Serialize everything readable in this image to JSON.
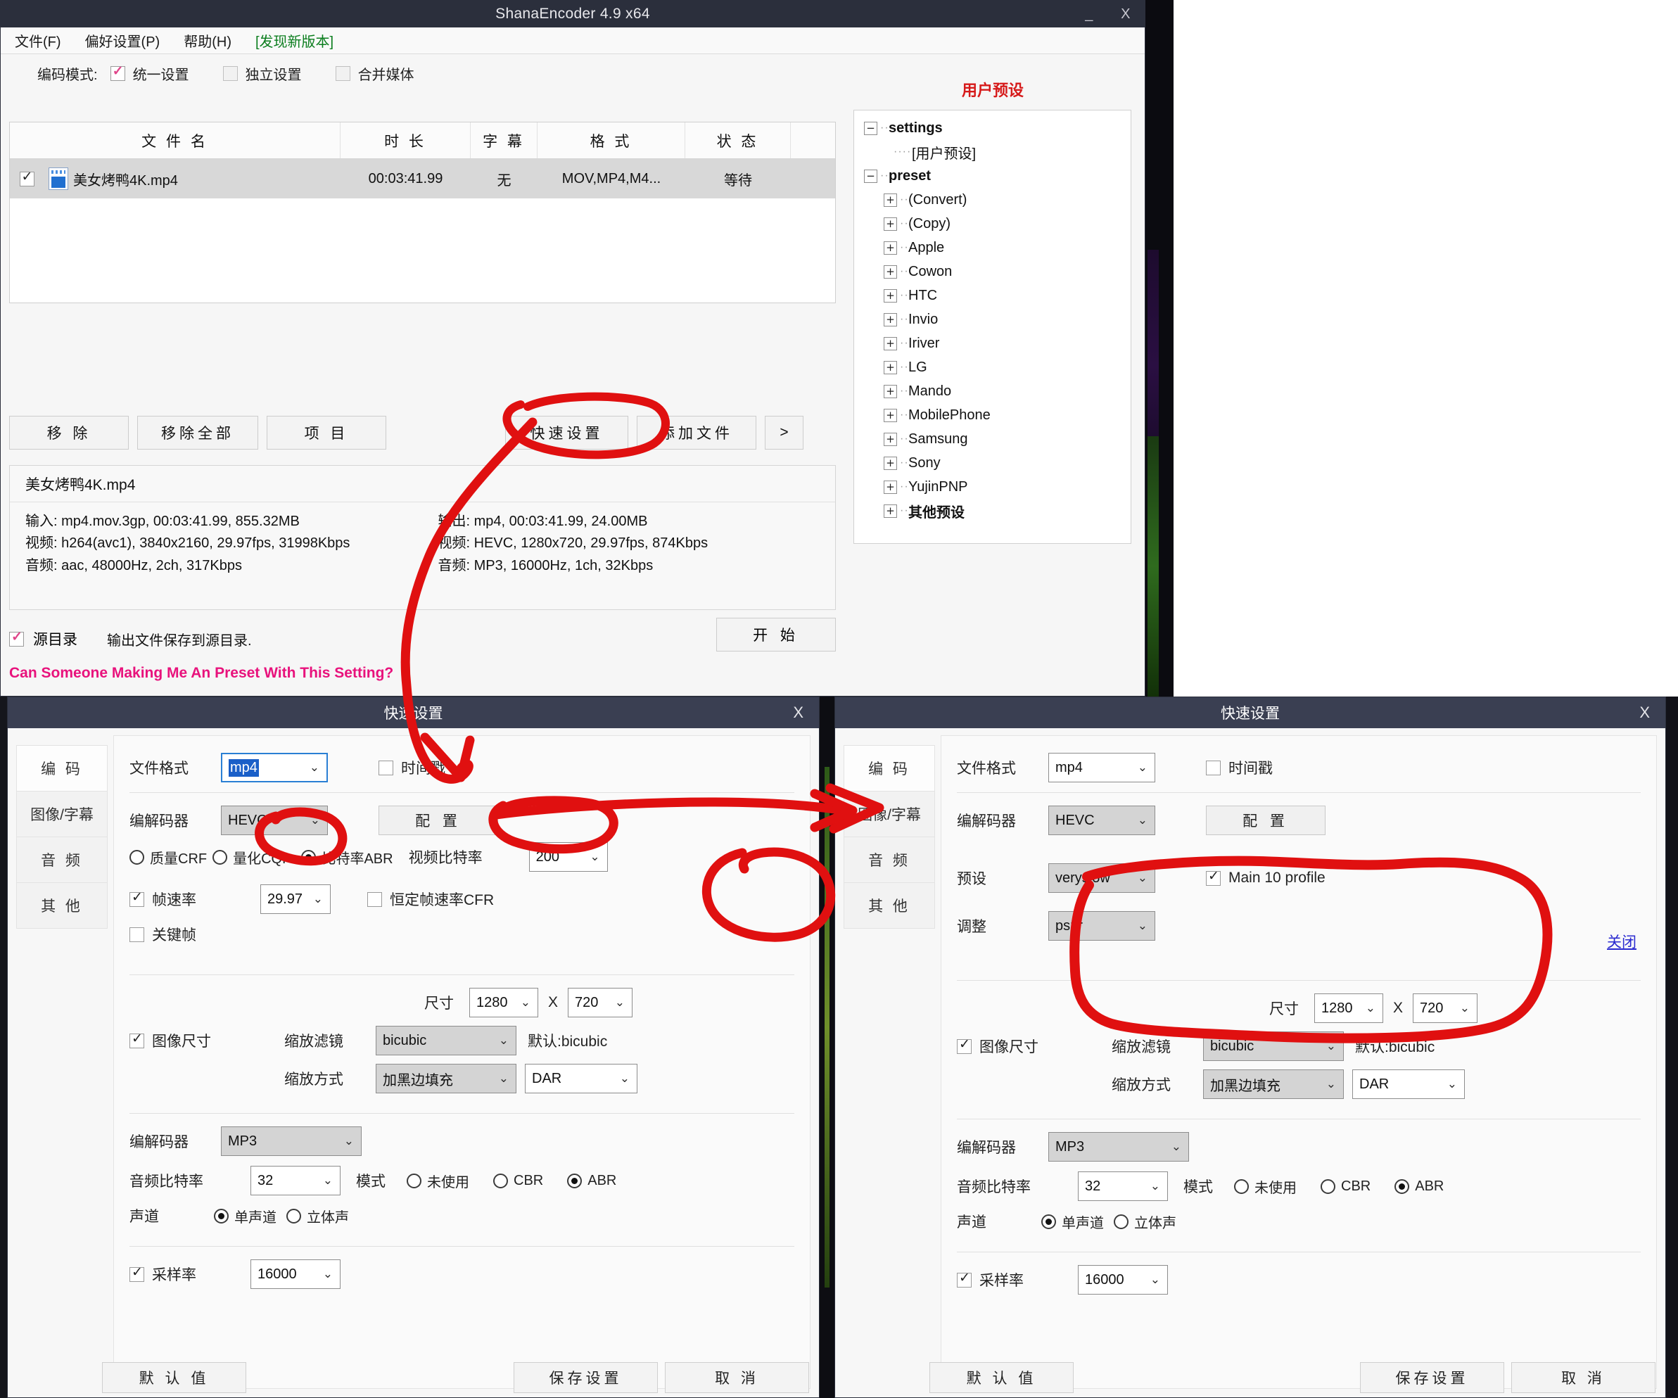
{
  "main_window": {
    "title": "ShanaEncoder 4.9 x64",
    "window_buttons": {
      "minimize": "_",
      "close": "X"
    },
    "menu": [
      {
        "label": "文件(F)"
      },
      {
        "label": "偏好设置(P)"
      },
      {
        "label": "帮助(H)"
      },
      {
        "label": "[发现新版本]",
        "color": "#0a7d1d"
      }
    ],
    "encode_mode": {
      "label": "编码模式:",
      "options": [
        {
          "label": "统一设置",
          "checked": true
        },
        {
          "label": "独立设置",
          "checked": false
        },
        {
          "label": "合并媒体",
          "checked": false
        }
      ]
    },
    "file_table": {
      "columns": [
        "文 件 名",
        "时 长",
        "字 幕",
        "格 式",
        "状 态"
      ],
      "rows": [
        {
          "checked": true,
          "name": "美女烤鸭4K.mp4",
          "duration": "00:03:41.99",
          "subtitle": "无",
          "format": "MOV,MP4,M4...",
          "status": "等待"
        }
      ]
    },
    "buttons": [
      "移 除",
      "移除全部",
      "项 目",
      "快速设置",
      "添加文件",
      ">"
    ],
    "info_panel": {
      "filename": "美女烤鸭4K.mp4",
      "input": [
        "输入: mp4.mov.3gp, 00:03:41.99, 855.32MB",
        "视频: h264(avc1), 3840x2160, 29.97fps, 31998Kbps",
        "音频: aac, 48000Hz, 2ch, 317Kbps"
      ],
      "output": [
        "输出: mp4, 00:03:41.99, 24.00MB",
        "视频: HEVC, 1280x720, 29.97fps, 874Kbps",
        "音频: MP3, 16000Hz, 1ch, 32Kbps"
      ]
    },
    "source_dir": {
      "checked": true,
      "label": "源目录",
      "note": "输出文件保存到源目录."
    },
    "start_button": "开 始",
    "pink_note": "Can Someone Making Me An Preset With This Setting?",
    "preset_panel": {
      "title": "用户预设",
      "tree": [
        {
          "level": 0,
          "expander": "−",
          "label": "settings"
        },
        {
          "level": 2,
          "expander": "",
          "label": "[用户预设]"
        },
        {
          "level": 0,
          "expander": "−",
          "label": "preset"
        },
        {
          "level": 1,
          "expander": "+",
          "label": "(Convert)"
        },
        {
          "level": 1,
          "expander": "+",
          "label": "(Copy)"
        },
        {
          "level": 1,
          "expander": "+",
          "label": "Apple"
        },
        {
          "level": 1,
          "expander": "+",
          "label": "Cowon"
        },
        {
          "level": 1,
          "expander": "+",
          "label": "HTC"
        },
        {
          "level": 1,
          "expander": "+",
          "label": "Invio"
        },
        {
          "level": 1,
          "expander": "+",
          "label": "Iriver"
        },
        {
          "level": 1,
          "expander": "+",
          "label": "LG"
        },
        {
          "level": 1,
          "expander": "+",
          "label": "Mando"
        },
        {
          "level": 1,
          "expander": "+",
          "label": "MobilePhone"
        },
        {
          "level": 1,
          "expander": "+",
          "label": "Samsung"
        },
        {
          "level": 1,
          "expander": "+",
          "label": "Sony"
        },
        {
          "level": 1,
          "expander": "+",
          "label": "YujinPNP"
        },
        {
          "level": 1,
          "expander": "+",
          "label": "其他预设"
        }
      ]
    }
  },
  "dialog_left": {
    "title": "快速设置",
    "close": "X",
    "tabs": [
      {
        "label": "编 码",
        "active": true
      },
      {
        "label": "图像/字幕",
        "active": false
      },
      {
        "label": "音 频",
        "active": false
      },
      {
        "label": "其 他",
        "active": false
      }
    ],
    "file_format": {
      "label": "文件格式",
      "value": "mp4"
    },
    "timestamp": {
      "label": "时间戳",
      "checked": false
    },
    "codec": {
      "label": "编解码器",
      "value": "HEVC"
    },
    "config_button": "配 置",
    "rate_modes": [
      {
        "label": "质量CRF",
        "selected": false
      },
      {
        "label": "量化CQP",
        "selected": false
      },
      {
        "label": "比特率ABR",
        "selected": true
      }
    ],
    "video_bitrate": {
      "label": "视频比特率",
      "value": "200"
    },
    "framerate": {
      "label": "帧速率",
      "checked": true,
      "value": "29.97"
    },
    "cfr": {
      "label": "恒定帧速率CFR",
      "checked": false
    },
    "keyframe": {
      "label": "关键帧",
      "checked": false
    },
    "image_size": {
      "checkbox_label": "图像尺寸",
      "checked": true,
      "size_label": "尺寸",
      "width": "1280",
      "x": "X",
      "height": "720",
      "filter_label": "缩放滤镜",
      "filter_value": "bicubic",
      "filter_default": "默认:bicubic",
      "mode_label": "缩放方式",
      "mode_value": "加黑边填充",
      "aspect_value": "DAR"
    },
    "audio": {
      "codec_label": "编解码器",
      "codec_value": "MP3",
      "bitrate_label": "音频比特率",
      "bitrate_value": "32",
      "mode_label": "模式",
      "modes": [
        {
          "label": "未使用",
          "selected": false
        },
        {
          "label": "CBR",
          "selected": false
        },
        {
          "label": "ABR",
          "selected": true
        }
      ],
      "channel_label": "声道",
      "channels": [
        {
          "label": "单声道",
          "selected": true
        },
        {
          "label": "立体声",
          "selected": false
        }
      ],
      "samplerate_label": "采样率",
      "samplerate_checked": true,
      "samplerate_value": "16000"
    },
    "footer": {
      "defaults": "默 认 值",
      "save": "保存设置",
      "cancel": "取 消"
    }
  },
  "dialog_right": {
    "title": "快速设置",
    "close": "X",
    "tabs": [
      {
        "label": "编 码",
        "active": true
      },
      {
        "label": "图像/字幕",
        "active": false
      },
      {
        "label": "音 频",
        "active": false
      },
      {
        "label": "其 他",
        "active": false
      }
    ],
    "file_format": {
      "label": "文件格式",
      "value": "mp4"
    },
    "timestamp": {
      "label": "时间戳",
      "checked": false
    },
    "codec": {
      "label": "编解码器",
      "value": "HEVC"
    },
    "config_button": "配 置",
    "preset": {
      "label": "预设",
      "value": "veryslow"
    },
    "tune": {
      "label": "调整",
      "value": "psnr"
    },
    "main10": {
      "label": "Main 10 profile",
      "checked": true
    },
    "close_link": "关闭",
    "image_size": {
      "checkbox_label": "图像尺寸",
      "checked": true,
      "size_label": "尺寸",
      "width": "1280",
      "x": "X",
      "height": "720",
      "filter_label": "缩放滤镜",
      "filter_value": "bicubic",
      "filter_default": "默认:bicubic",
      "mode_label": "缩放方式",
      "mode_value": "加黑边填充",
      "aspect_value": "DAR"
    },
    "audio": {
      "codec_label": "编解码器",
      "codec_value": "MP3",
      "bitrate_label": "音频比特率",
      "bitrate_value": "32",
      "mode_label": "模式",
      "modes": [
        {
          "label": "未使用",
          "selected": false
        },
        {
          "label": "CBR",
          "selected": false
        },
        {
          "label": "ABR",
          "selected": true
        }
      ],
      "channel_label": "声道",
      "channels": [
        {
          "label": "单声道",
          "selected": true
        },
        {
          "label": "立体声",
          "selected": false
        }
      ],
      "samplerate_label": "采样率",
      "samplerate_checked": true,
      "samplerate_value": "16000"
    },
    "footer": {
      "defaults": "默 认 值",
      "save": "保存设置",
      "cancel": "取 消"
    }
  },
  "annotations": {
    "color": "#e01010",
    "marks": [
      "circle-around-quick-settings-button",
      "arrow-to-file-format-combo",
      "circle-around-hevc-combo",
      "circle-around-config-button",
      "circle-around-video-bitrate-200",
      "arrow-to-right-dialog-encode-tab",
      "circle-around-preset-tune-main10"
    ]
  }
}
